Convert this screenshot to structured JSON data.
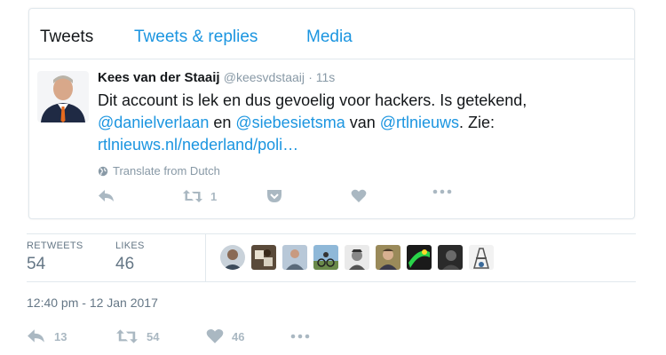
{
  "tabs": [
    "Tweets",
    "Tweets & replies",
    "Media"
  ],
  "tweet": {
    "name": "Kees van der Staaij",
    "handle": "@keesvdstaaij",
    "time": "· 11s",
    "text_1": "Dit account is lek en dus gevoelig voor hackers. Is getekend,",
    "mention_1": "@danielverlaan",
    "text_2": " en ",
    "mention_2": "@siebesietsma",
    "text_3": " van ",
    "mention_3": "@rtlnieuws",
    "text_4": ". Zie:",
    "link": "rtlnieuws.nl/nederland/poli…",
    "translate": "Translate from Dutch",
    "retweet_count": "1"
  },
  "stats": {
    "retweets_label": "RETWEETS",
    "retweets_value": "54",
    "likes_label": "LIKES",
    "likes_value": "46"
  },
  "timestamp": "12:40 pm - 12 Jan 2017",
  "bottom_actions": {
    "reply_count": "13",
    "retweet_count": "54",
    "like_count": "46"
  },
  "colors": {
    "link": "#1b95e0",
    "muted": "#8899a6",
    "icon": "#aab8c2",
    "border": "#e1e8ed"
  }
}
